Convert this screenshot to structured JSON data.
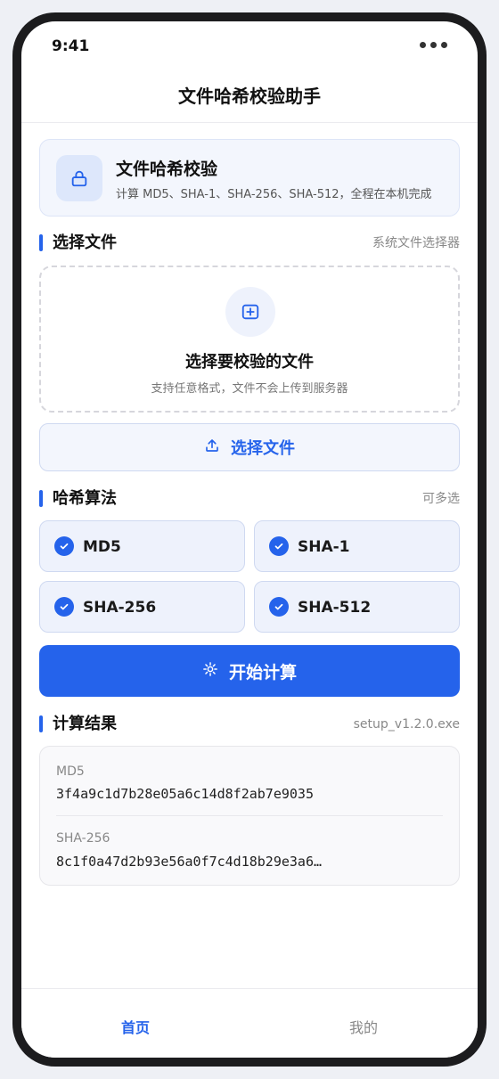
{
  "status_bar": {
    "time": "9:41"
  },
  "header": {
    "title": "文件哈希校验助手"
  },
  "intro": {
    "icon": "lock-icon",
    "title": "文件哈希校验",
    "description": "计算 MD5、SHA-1、SHA-256、SHA-512，全程在本机完成"
  },
  "file_section": {
    "title": "选择文件",
    "hint": "系统文件选择器",
    "dropzone_icon": "file-plus-icon",
    "dropzone_title": "选择要校验的文件",
    "dropzone_desc": "支持任意格式，文件不会上传到服务器",
    "button_icon": "upload-icon",
    "button_label": "选择文件"
  },
  "algo_section": {
    "title": "哈希算法",
    "hint": "可多选",
    "options": [
      {
        "label": "MD5",
        "checked": true
      },
      {
        "label": "SHA-1",
        "checked": true
      },
      {
        "label": "SHA-256",
        "checked": true
      },
      {
        "label": "SHA-512",
        "checked": true
      }
    ]
  },
  "start_button": {
    "icon": "gear-icon",
    "label": "开始计算"
  },
  "result_section": {
    "title": "计算结果",
    "filename": "setup_v1.2.0.exe",
    "items": [
      {
        "algo": "MD5",
        "hash": "3f4a9c1d7b28e05a6c14d8f2ab7e9035"
      },
      {
        "algo": "SHA-256",
        "hash": "8c1f0a47d2b93e56a0f7c4d18b29e3a6…"
      }
    ]
  },
  "tabbar": {
    "tabs": [
      {
        "label": "首页",
        "active": true
      },
      {
        "label": "我的",
        "active": false
      }
    ]
  },
  "colors": {
    "accent": "#2563eb",
    "inactive_tab": "#888888"
  }
}
